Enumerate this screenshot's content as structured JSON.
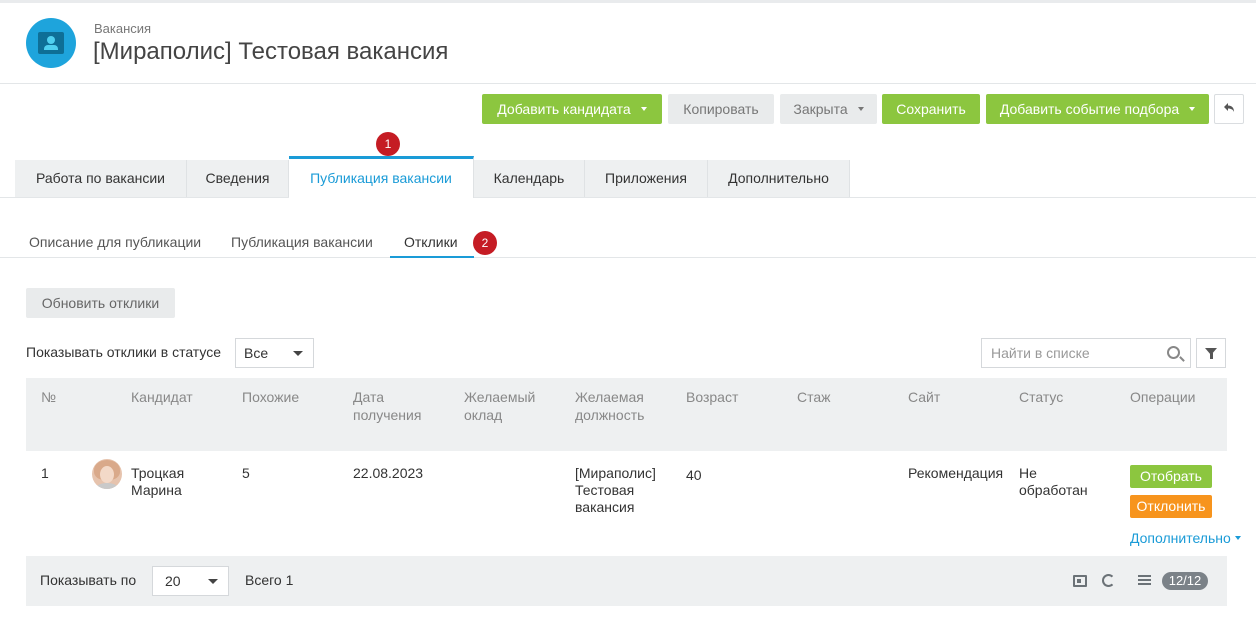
{
  "header": {
    "subtitle": "Вакансия",
    "title": "[Мираполис] Тестовая вакансия"
  },
  "toolbar": {
    "add_candidate": "Добавить кандидата",
    "copy": "Копировать",
    "closed": "Закрыта",
    "save": "Сохранить",
    "add_event": "Добавить событие подбора"
  },
  "tabs": [
    {
      "label": "Работа по вакансии"
    },
    {
      "label": "Сведения"
    },
    {
      "label": "Публикация вакансии"
    },
    {
      "label": "Календарь"
    },
    {
      "label": "Приложения"
    },
    {
      "label": "Дополнительно"
    }
  ],
  "active_tab": "Публикация вакансии",
  "badges": [
    "1",
    "2"
  ],
  "subtabs": [
    {
      "label": "Описание для публикации"
    },
    {
      "label": "Публикация вакансии"
    },
    {
      "label": "Отклики"
    }
  ],
  "active_subtab": "Отклики",
  "responses": {
    "refresh_button": "Обновить отклики",
    "filter_label": "Показывать отклики в статусе",
    "status_select": "Все",
    "search_placeholder": "Найти в списке"
  },
  "table": {
    "columns": [
      "№",
      "Кандидат",
      "Похожие",
      "Дата получения",
      "Желаемый оклад",
      "Желаемая должность",
      "Возраст",
      "Стаж",
      "Сайт",
      "Статус",
      "Операции"
    ],
    "rows": [
      {
        "num": "1",
        "candidate": "Троцкая Марина",
        "similar": "5",
        "date": "22.08.2023",
        "salary": "",
        "position": "[Мираполис] Тестовая вакансия",
        "age": "40",
        "experience": "",
        "site": "Рекомендация",
        "status": "Не обработан",
        "ops": {
          "select": "Отобрать",
          "reject": "Отклонить",
          "more": "Дополнительно"
        }
      }
    ]
  },
  "footer": {
    "show_by_label": "Показывать по",
    "page_size": "20",
    "total": "Всего 1",
    "pages": "12/12"
  },
  "colors": {
    "green": "#8cc63f",
    "orange": "#f7941d",
    "blue": "#1a9bd7",
    "badge_red": "#c51c24"
  }
}
